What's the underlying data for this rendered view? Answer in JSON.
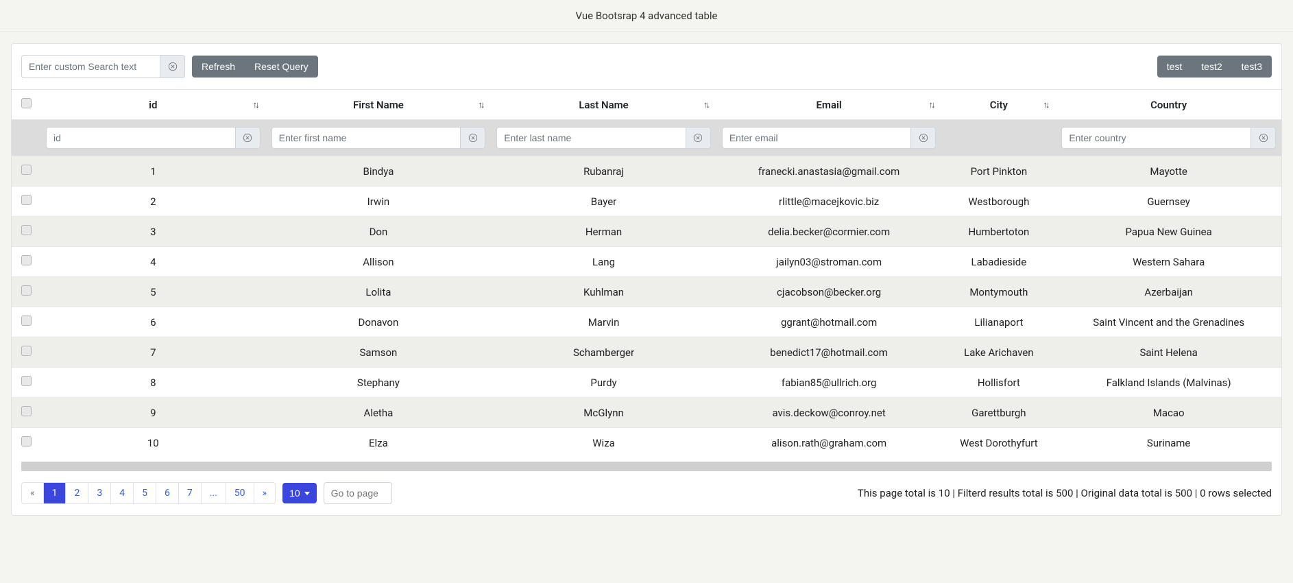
{
  "header": {
    "title": "Vue Bootsrap 4 advanced table"
  },
  "toolbar": {
    "search_placeholder": "Enter custom Search text",
    "refresh_label": "Refresh",
    "reset_query_label": "Reset Query",
    "right_buttons": [
      "test",
      "test2",
      "test3"
    ]
  },
  "columns": [
    {
      "label": "",
      "sortable": false,
      "filter": null
    },
    {
      "label": "id",
      "sortable": true,
      "filter": {
        "placeholder": "id"
      }
    },
    {
      "label": "First Name",
      "sortable": true,
      "filter": {
        "placeholder": "Enter first name"
      }
    },
    {
      "label": "Last Name",
      "sortable": true,
      "filter": {
        "placeholder": "Enter last name"
      }
    },
    {
      "label": "Email",
      "sortable": true,
      "filter": {
        "placeholder": "Enter email"
      }
    },
    {
      "label": "City",
      "sortable": true,
      "filter": null
    },
    {
      "label": "Country",
      "sortable": false,
      "filter": {
        "placeholder": "Enter country"
      }
    }
  ],
  "rows": [
    {
      "id": "1",
      "first": "Bindya",
      "last": "Rubanraj",
      "email": "franecki.anastasia@gmail.com",
      "city": "Port Pinkton",
      "country": "Mayotte"
    },
    {
      "id": "2",
      "first": "Irwin",
      "last": "Bayer",
      "email": "rlittle@macejkovic.biz",
      "city": "Westborough",
      "country": "Guernsey"
    },
    {
      "id": "3",
      "first": "Don",
      "last": "Herman",
      "email": "delia.becker@cormier.com",
      "city": "Humbertoton",
      "country": "Papua New Guinea"
    },
    {
      "id": "4",
      "first": "Allison",
      "last": "Lang",
      "email": "jailyn03@stroman.com",
      "city": "Labadieside",
      "country": "Western Sahara"
    },
    {
      "id": "5",
      "first": "Lolita",
      "last": "Kuhlman",
      "email": "cjacobson@becker.org",
      "city": "Montymouth",
      "country": "Azerbaijan"
    },
    {
      "id": "6",
      "first": "Donavon",
      "last": "Marvin",
      "email": "ggrant@hotmail.com",
      "city": "Lilianaport",
      "country": "Saint Vincent and the Grenadines"
    },
    {
      "id": "7",
      "first": "Samson",
      "last": "Schamberger",
      "email": "benedict17@hotmail.com",
      "city": "Lake Arichaven",
      "country": "Saint Helena"
    },
    {
      "id": "8",
      "first": "Stephany",
      "last": "Purdy",
      "email": "fabian85@ullrich.org",
      "city": "Hollisfort",
      "country": "Falkland Islands (Malvinas)"
    },
    {
      "id": "9",
      "first": "Aletha",
      "last": "McGlynn",
      "email": "avis.deckow@conroy.net",
      "city": "Garettburgh",
      "country": "Macao"
    },
    {
      "id": "10",
      "first": "Elza",
      "last": "Wiza",
      "email": "alison.rath@graham.com",
      "city": "West Dorothyfurt",
      "country": "Suriname"
    }
  ],
  "pagination": {
    "pages": [
      "«",
      "1",
      "2",
      "3",
      "4",
      "5",
      "6",
      "7",
      "...",
      "50",
      "»"
    ],
    "active_index": 1,
    "page_size": "10",
    "goto_placeholder": "Go to page"
  },
  "footer_status": {
    "page_total_prefix": "This page total is ",
    "page_total": "10",
    "filtered_prefix": " | Filterd results total is ",
    "filtered_total": "500",
    "original_prefix": " | Original data total is ",
    "original_total": "500",
    "selected_prefix": " | ",
    "selected_count": "0",
    "selected_suffix": " rows selected"
  }
}
